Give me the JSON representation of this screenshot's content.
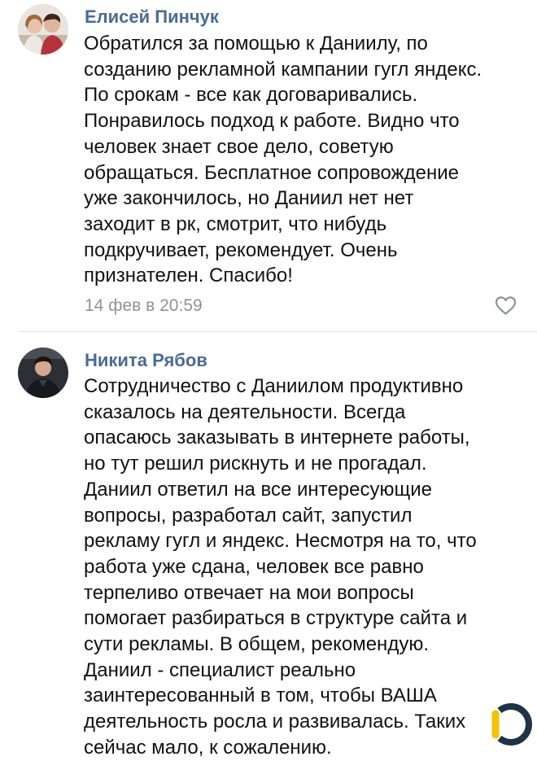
{
  "comments": [
    {
      "author": "Елисей Пинчук",
      "lines": [
        "Обратился за помощью к Даниилу, по",
        "созданию рекламной кампании гугл яндекс.",
        "По срокам - все как договаривались.",
        "Понравилось подход к работе. Видно что",
        "человек знает свое дело, советую",
        "обращаться. Бесплатное сопровождение",
        "уже закончилось, но Даниил нет нет",
        "заходит в рк, смотрит, что нибудь",
        "подкручивает, рекомендует. Очень",
        "признателен. Спасибо!"
      ],
      "date": "14 фев в 20:59",
      "icons": {
        "like": "heart-outline-icon",
        "avatar": "couple-photo"
      }
    },
    {
      "author": "Никита Рябов",
      "lines": [
        "Сотрудничество с Даниилом продуктивно",
        "сказалось на деятельности. Всегда",
        "опасаюсь заказывать в интернете работы,",
        "но тут решил рискнуть и не прогадал.",
        "Даниил ответил на все интересующие",
        "вопросы, разработал сайт, запустил",
        "рекламу гугл и яндекс. Несмотря на то, что",
        "работа уже сдана, человек все равно",
        "терпеливо отвечает на мои вопросы",
        "помогает разбираться в структуре сайта и",
        "сути рекламы. В общем, рекомендую.",
        "Даниил - специалист реально",
        "заинтересованный в том, чтобы ВАША",
        "деятельность росла и развивалась. Таких",
        "сейчас мало, к сожалению."
      ],
      "icons": {
        "avatar": "man-photo"
      }
    }
  ],
  "colors": {
    "author": "#4a6b93",
    "meta": "#8c9399",
    "divider": "#dcdfe3",
    "logo_ring": "#1f3346",
    "logo_accent": "#f2c200"
  },
  "watermark": {
    "icon": "brand-logo-icon"
  }
}
